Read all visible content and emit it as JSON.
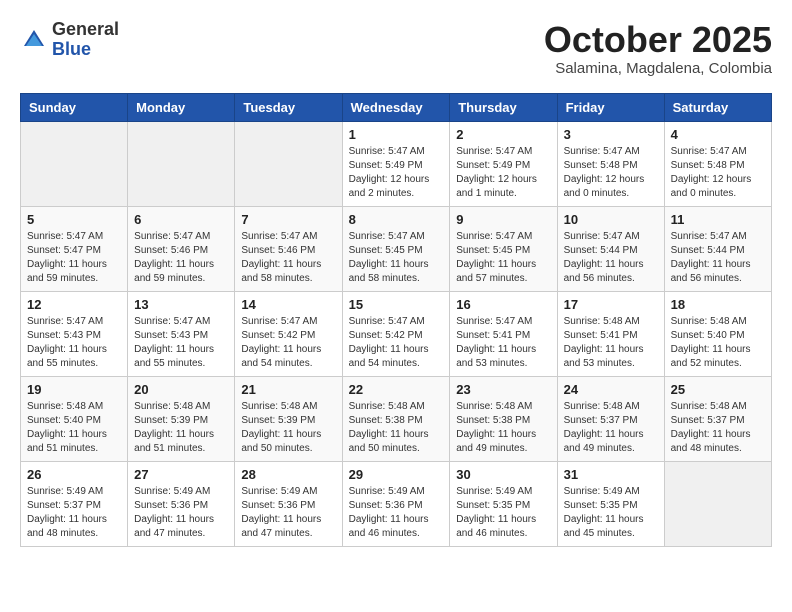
{
  "logo": {
    "general": "General",
    "blue": "Blue"
  },
  "title": "October 2025",
  "subtitle": "Salamina, Magdalena, Colombia",
  "days_header": [
    "Sunday",
    "Monday",
    "Tuesday",
    "Wednesday",
    "Thursday",
    "Friday",
    "Saturday"
  ],
  "weeks": [
    [
      {
        "day": "",
        "sunrise": "",
        "sunset": "",
        "daylight": ""
      },
      {
        "day": "",
        "sunrise": "",
        "sunset": "",
        "daylight": ""
      },
      {
        "day": "",
        "sunrise": "",
        "sunset": "",
        "daylight": ""
      },
      {
        "day": "1",
        "sunrise": "Sunrise: 5:47 AM",
        "sunset": "Sunset: 5:49 PM",
        "daylight": "Daylight: 12 hours and 2 minutes."
      },
      {
        "day": "2",
        "sunrise": "Sunrise: 5:47 AM",
        "sunset": "Sunset: 5:49 PM",
        "daylight": "Daylight: 12 hours and 1 minute."
      },
      {
        "day": "3",
        "sunrise": "Sunrise: 5:47 AM",
        "sunset": "Sunset: 5:48 PM",
        "daylight": "Daylight: 12 hours and 0 minutes."
      },
      {
        "day": "4",
        "sunrise": "Sunrise: 5:47 AM",
        "sunset": "Sunset: 5:48 PM",
        "daylight": "Daylight: 12 hours and 0 minutes."
      }
    ],
    [
      {
        "day": "5",
        "sunrise": "Sunrise: 5:47 AM",
        "sunset": "Sunset: 5:47 PM",
        "daylight": "Daylight: 11 hours and 59 minutes."
      },
      {
        "day": "6",
        "sunrise": "Sunrise: 5:47 AM",
        "sunset": "Sunset: 5:46 PM",
        "daylight": "Daylight: 11 hours and 59 minutes."
      },
      {
        "day": "7",
        "sunrise": "Sunrise: 5:47 AM",
        "sunset": "Sunset: 5:46 PM",
        "daylight": "Daylight: 11 hours and 58 minutes."
      },
      {
        "day": "8",
        "sunrise": "Sunrise: 5:47 AM",
        "sunset": "Sunset: 5:45 PM",
        "daylight": "Daylight: 11 hours and 58 minutes."
      },
      {
        "day": "9",
        "sunrise": "Sunrise: 5:47 AM",
        "sunset": "Sunset: 5:45 PM",
        "daylight": "Daylight: 11 hours and 57 minutes."
      },
      {
        "day": "10",
        "sunrise": "Sunrise: 5:47 AM",
        "sunset": "Sunset: 5:44 PM",
        "daylight": "Daylight: 11 hours and 56 minutes."
      },
      {
        "day": "11",
        "sunrise": "Sunrise: 5:47 AM",
        "sunset": "Sunset: 5:44 PM",
        "daylight": "Daylight: 11 hours and 56 minutes."
      }
    ],
    [
      {
        "day": "12",
        "sunrise": "Sunrise: 5:47 AM",
        "sunset": "Sunset: 5:43 PM",
        "daylight": "Daylight: 11 hours and 55 minutes."
      },
      {
        "day": "13",
        "sunrise": "Sunrise: 5:47 AM",
        "sunset": "Sunset: 5:43 PM",
        "daylight": "Daylight: 11 hours and 55 minutes."
      },
      {
        "day": "14",
        "sunrise": "Sunrise: 5:47 AM",
        "sunset": "Sunset: 5:42 PM",
        "daylight": "Daylight: 11 hours and 54 minutes."
      },
      {
        "day": "15",
        "sunrise": "Sunrise: 5:47 AM",
        "sunset": "Sunset: 5:42 PM",
        "daylight": "Daylight: 11 hours and 54 minutes."
      },
      {
        "day": "16",
        "sunrise": "Sunrise: 5:47 AM",
        "sunset": "Sunset: 5:41 PM",
        "daylight": "Daylight: 11 hours and 53 minutes."
      },
      {
        "day": "17",
        "sunrise": "Sunrise: 5:48 AM",
        "sunset": "Sunset: 5:41 PM",
        "daylight": "Daylight: 11 hours and 53 minutes."
      },
      {
        "day": "18",
        "sunrise": "Sunrise: 5:48 AM",
        "sunset": "Sunset: 5:40 PM",
        "daylight": "Daylight: 11 hours and 52 minutes."
      }
    ],
    [
      {
        "day": "19",
        "sunrise": "Sunrise: 5:48 AM",
        "sunset": "Sunset: 5:40 PM",
        "daylight": "Daylight: 11 hours and 51 minutes."
      },
      {
        "day": "20",
        "sunrise": "Sunrise: 5:48 AM",
        "sunset": "Sunset: 5:39 PM",
        "daylight": "Daylight: 11 hours and 51 minutes."
      },
      {
        "day": "21",
        "sunrise": "Sunrise: 5:48 AM",
        "sunset": "Sunset: 5:39 PM",
        "daylight": "Daylight: 11 hours and 50 minutes."
      },
      {
        "day": "22",
        "sunrise": "Sunrise: 5:48 AM",
        "sunset": "Sunset: 5:38 PM",
        "daylight": "Daylight: 11 hours and 50 minutes."
      },
      {
        "day": "23",
        "sunrise": "Sunrise: 5:48 AM",
        "sunset": "Sunset: 5:38 PM",
        "daylight": "Daylight: 11 hours and 49 minutes."
      },
      {
        "day": "24",
        "sunrise": "Sunrise: 5:48 AM",
        "sunset": "Sunset: 5:37 PM",
        "daylight": "Daylight: 11 hours and 49 minutes."
      },
      {
        "day": "25",
        "sunrise": "Sunrise: 5:48 AM",
        "sunset": "Sunset: 5:37 PM",
        "daylight": "Daylight: 11 hours and 48 minutes."
      }
    ],
    [
      {
        "day": "26",
        "sunrise": "Sunrise: 5:49 AM",
        "sunset": "Sunset: 5:37 PM",
        "daylight": "Daylight: 11 hours and 48 minutes."
      },
      {
        "day": "27",
        "sunrise": "Sunrise: 5:49 AM",
        "sunset": "Sunset: 5:36 PM",
        "daylight": "Daylight: 11 hours and 47 minutes."
      },
      {
        "day": "28",
        "sunrise": "Sunrise: 5:49 AM",
        "sunset": "Sunset: 5:36 PM",
        "daylight": "Daylight: 11 hours and 47 minutes."
      },
      {
        "day": "29",
        "sunrise": "Sunrise: 5:49 AM",
        "sunset": "Sunset: 5:36 PM",
        "daylight": "Daylight: 11 hours and 46 minutes."
      },
      {
        "day": "30",
        "sunrise": "Sunrise: 5:49 AM",
        "sunset": "Sunset: 5:35 PM",
        "daylight": "Daylight: 11 hours and 46 minutes."
      },
      {
        "day": "31",
        "sunrise": "Sunrise: 5:49 AM",
        "sunset": "Sunset: 5:35 PM",
        "daylight": "Daylight: 11 hours and 45 minutes."
      },
      {
        "day": "",
        "sunrise": "",
        "sunset": "",
        "daylight": ""
      }
    ]
  ]
}
